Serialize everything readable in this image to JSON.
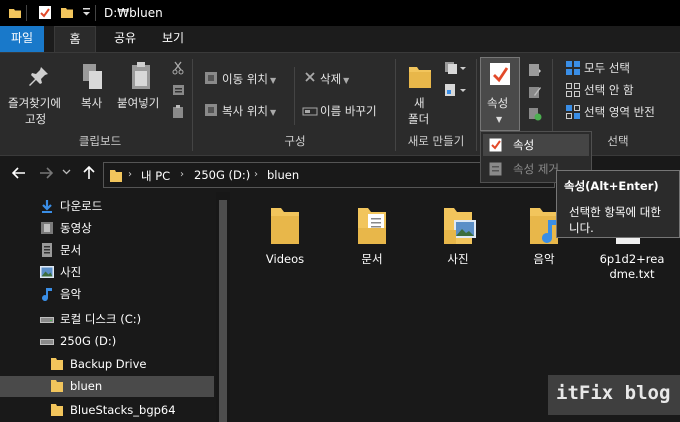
{
  "titlebar": {
    "title": "D:₩bluen"
  },
  "tabs": [
    {
      "label": "파일"
    },
    {
      "label": "홈"
    },
    {
      "label": "공유"
    },
    {
      "label": "보기"
    }
  ],
  "ribbon": {
    "pin_label_1": "즐겨찾기에",
    "pin_label_2": "고정",
    "copy_label": "복사",
    "paste_label": "붙여넣기",
    "clipboard_group": "클립보드",
    "move_to": "이동 위치",
    "copy_to": "복사 위치",
    "delete": "삭제",
    "rename": "이름 바꾸기",
    "organize_group": "구성",
    "new_folder_1": "새",
    "new_folder_2": "폴더",
    "new_group": "새로 만들기",
    "properties": "속성",
    "select_all": "모두 선택",
    "select_none": "선택 안 함",
    "invert_selection": "선택 영역 반전",
    "select_group": "선택"
  },
  "address": {
    "crumbs": [
      "내 PC",
      "250G (D:)",
      "bluen"
    ]
  },
  "nav": {
    "items": [
      {
        "label": "다운로드"
      },
      {
        "label": "동영상"
      },
      {
        "label": "문서"
      },
      {
        "label": "사진"
      },
      {
        "label": "음악"
      },
      {
        "label": "로컬 디스크 (C:)"
      },
      {
        "label": "250G (D:)"
      },
      {
        "label": "Backup Drive"
      },
      {
        "label": "bluen"
      },
      {
        "label": "BlueStacks_bgp64"
      }
    ]
  },
  "files": [
    {
      "label": "Videos"
    },
    {
      "label": "문서"
    },
    {
      "label": "사진"
    },
    {
      "label": "음악"
    },
    {
      "label_1": "6p1d2+rea",
      "label_2": "dme.txt"
    }
  ],
  "menu": {
    "properties": "속성",
    "remove_properties": "속성 제거"
  },
  "tooltip": {
    "title": "속성(Alt+Enter)",
    "desc_1": "선택한 항목에 대한",
    "desc_2": "니다."
  },
  "watermark": {
    "text": "itFix blog"
  },
  "colors": {
    "accent": "#1979ca",
    "folder": "#f2c55c",
    "check": "#e24a2a"
  }
}
